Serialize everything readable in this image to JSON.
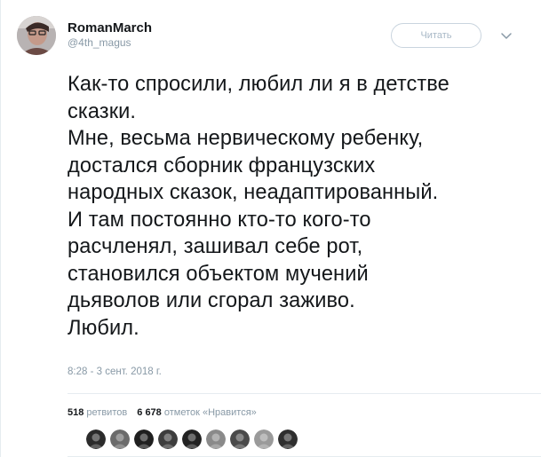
{
  "author": {
    "display_name": "RomanMarch",
    "username": "@4th_magus"
  },
  "follow_button_label": "Читать",
  "tweet": {
    "lines": [
      "Как-то спросили, любил ли я в детстве",
      "сказки.",
      "Мне, весьма нервическому ребенку,",
      "достался сборник французских",
      "народных сказок, неадаптированный.",
      "И там постоянно кто-то кого-то",
      "расчленял, зашивал себе рот,",
      "становился объектом мучений",
      "дьяволов или сгорал заживо.",
      "Любил."
    ],
    "timestamp": "8:28 - 3 сент. 2018 г."
  },
  "stats": {
    "retweets_count": "518",
    "retweets_label": "ретвитов",
    "likes_count": "6 678",
    "likes_label": "отметок «Нравится»"
  },
  "liker_avatars": [
    {
      "icon": "avatar-1",
      "color": "#2b2b2b"
    },
    {
      "icon": "avatar-2",
      "color": "#6b6b6b"
    },
    {
      "icon": "avatar-3",
      "color": "#1f1f1f"
    },
    {
      "icon": "avatar-4",
      "color": "#3d3d3d"
    },
    {
      "icon": "avatar-5",
      "color": "#222222"
    },
    {
      "icon": "avatar-6",
      "color": "#8a8a8a"
    },
    {
      "icon": "avatar-7",
      "color": "#4a4a4a"
    },
    {
      "icon": "avatar-8",
      "color": "#9a9a9a"
    },
    {
      "icon": "avatar-9",
      "color": "#2f2f2f"
    }
  ],
  "colors": {
    "text": "#14171a",
    "secondary_text": "#8899a6",
    "border": "#e6ecf0"
  }
}
